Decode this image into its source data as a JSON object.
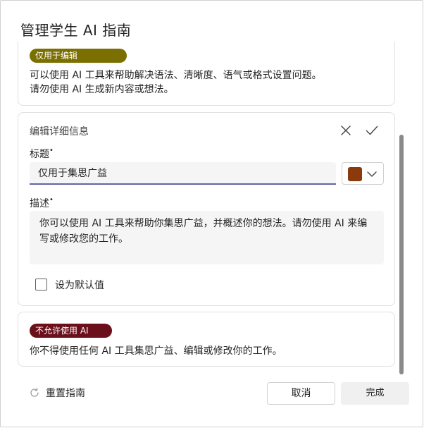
{
  "dialog": {
    "title": "管理学生 AI 指南"
  },
  "cards": {
    "editing_only": {
      "badge": "仅用于编辑",
      "badge_color": "#7a6f00",
      "line1": "可以使用 AI 工具来帮助解决语法、清晰度、语气或格式设置问题。",
      "line2": "请勿使用 AI 生成新内容或想法。"
    },
    "edit_details": {
      "header": "编辑详细信息",
      "close_icon": "close-icon",
      "confirm_icon": "checkmark-icon",
      "title_label": "标题",
      "title_value": "仅用于集思广益",
      "color_value": "#8b3a0e",
      "description_label": "描述",
      "description_value": "你可以使用 AI 工具来帮助你集思广益，并概述你的想法。请勿使用 AI 来编写或修改您的工作。",
      "default_checkbox_label": "设为默认值",
      "default_checked": false
    },
    "no_ai": {
      "badge": "不允许使用 AI",
      "badge_color": "#6b0f1a",
      "line1": "你不得使用任何 AI 工具集思广益、编辑或修改你的工作。"
    }
  },
  "footer": {
    "reset_label": "重置指南",
    "reset_icon": "refresh-icon",
    "cancel_label": "取消",
    "done_label": "完成"
  }
}
